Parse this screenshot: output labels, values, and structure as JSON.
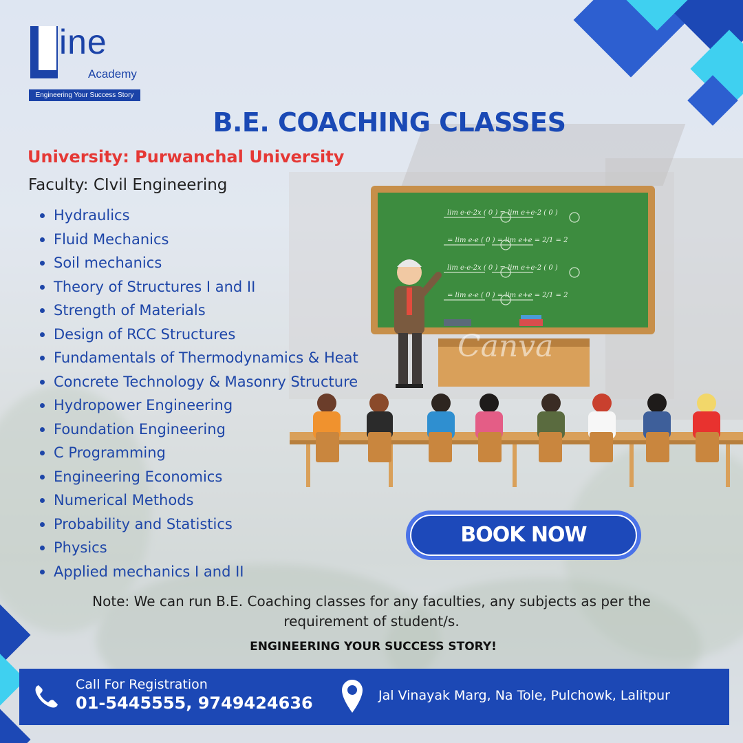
{
  "brand": {
    "logo_text": "ine",
    "logo_sub": "Academy",
    "logo_tagline": "Engineering Your Success Story"
  },
  "title": "B.E. COACHING CLASSES",
  "university": "University: Purwanchal University",
  "faculty": "Faculty: CIvil Engineering",
  "subjects": [
    "Hydraulics",
    "Fluid Mechanics",
    "Soil mechanics",
    "Theory of Structures I and II",
    "Strength of Materials",
    "Design of RCC Structures",
    "Fundamentals of Thermodynamics & Heat",
    "Concrete Technology & Masonry Structure",
    "Hydropower Engineering",
    "Foundation Engineering",
    "C Programming",
    "Engineering Economics",
    "Numerical Methods",
    "Probability and Statistics",
    "Physics",
    "Applied mechanics I and II"
  ],
  "cta": {
    "label": "BOOK NOW"
  },
  "watermark": "Canva",
  "note": "Note: We can run B.E. Coaching classes for any faculties, any subjects as per the requirement of student/s.",
  "slogan": "ENGINEERING YOUR SUCCESS STORY!",
  "contact": {
    "call_label": "Call For Registration",
    "phone_numbers": "01-5445555, 9749424636",
    "address": "Jal Vinayak Marg, Na Tole, Pulchowk, Lalitpur"
  },
  "icons": [
    "phone-icon",
    "location-pin-icon"
  ],
  "colors": {
    "primary_blue": "#1c48b5",
    "accent_red": "#e53835",
    "cyan": "#3fd0f0",
    "chalkboard_green": "#3d8c3f"
  }
}
